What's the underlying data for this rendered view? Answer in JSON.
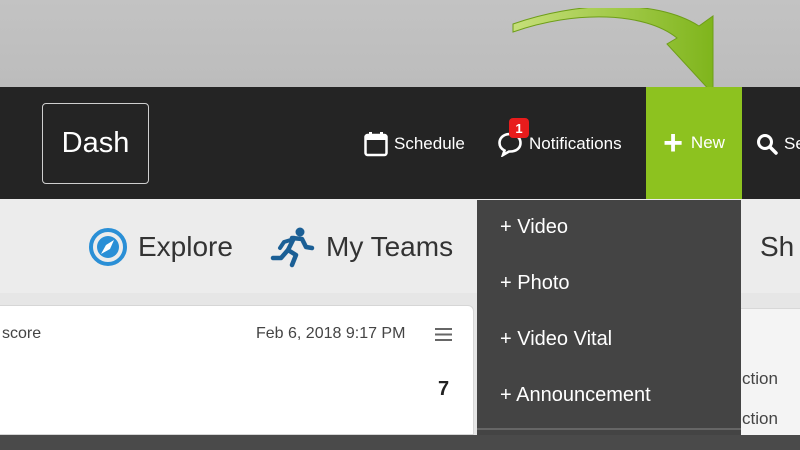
{
  "navbar": {
    "logo": "Dash",
    "schedule_label": "Schedule",
    "notifications_label": "Notifications",
    "notifications_badge": "1",
    "new_label": "New",
    "search_label": "Se",
    "accent_color": "#8dc21f"
  },
  "subnav": {
    "explore_label": "Explore",
    "myteams_label": "My Teams",
    "more_label": "Sh"
  },
  "card": {
    "title": "score",
    "date": "Feb 6, 2018 9:17 PM",
    "count": "7"
  },
  "right_panel": {
    "rows": [
      "ction",
      "ction"
    ]
  },
  "new_menu": {
    "items": [
      "+ Video",
      "+ Photo",
      "+ Video Vital",
      "+ Announcement"
    ]
  },
  "icons": {
    "schedule": "calendar-icon",
    "notifications": "chat-bubble-icon",
    "new": "plus-icon",
    "search": "search-icon",
    "explore": "compass-icon",
    "myteams": "runner-icon",
    "card_menu": "hamburger-menu-icon",
    "annotation": "curved-arrow-icon"
  }
}
